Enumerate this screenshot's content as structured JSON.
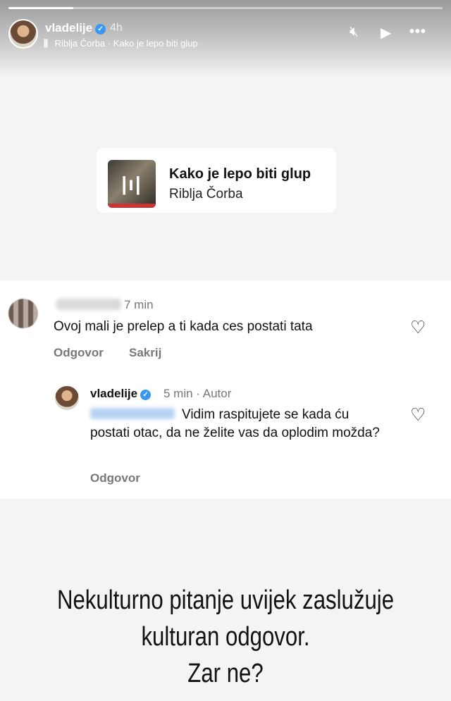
{
  "story": {
    "progress": 0.15,
    "username": "vladelije",
    "time": "4h",
    "music_line": "Riblja Čorba · Kako je lepo biti glup",
    "controls": [
      "mute-icon",
      "play-icon",
      "more-icon"
    ]
  },
  "music_sticker": {
    "song": "Kako je lepo biti glup",
    "artist": "Riblja Čorba"
  },
  "comments": [
    {
      "time": "7 min",
      "text": "Ovoj mali je prelep a ti kada ces postati tata",
      "reply_label": "Odgovor",
      "hide_label": "Sakrij"
    },
    {
      "username": "vladelije",
      "time": "5 min · Autor",
      "text": "Vidim raspitujete se kada ću postati otac, da ne želite vas da oplodim možda?",
      "reply_label": "Odgovor"
    }
  ],
  "caption": {
    "line1": "Nekulturno pitanje uvijek zaslužuje",
    "line2": "kulturan odgovor.",
    "line3": "Zar ne?"
  }
}
